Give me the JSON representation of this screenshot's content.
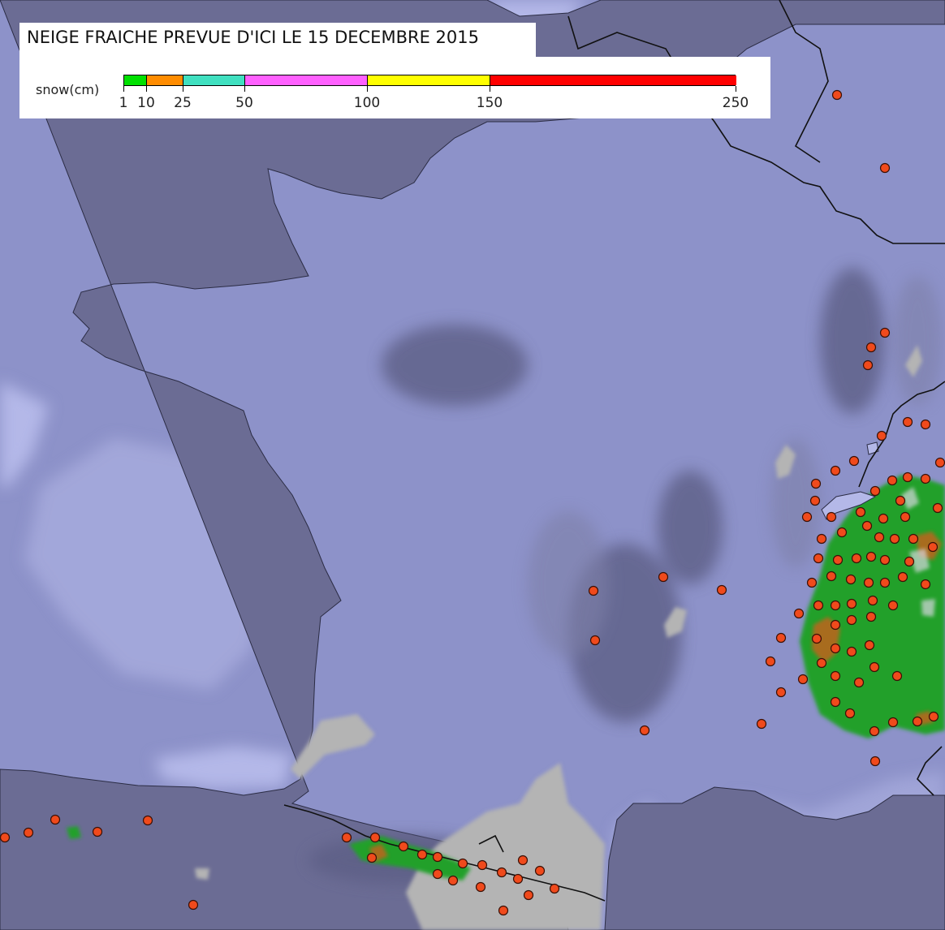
{
  "title": "NEIGE FRAICHE PREVUE D'ICI LE 15 DECEMBRE 2015",
  "legend": {
    "label": "snow(cm)",
    "breaks": [
      1,
      10,
      25,
      50,
      100,
      150,
      250
    ],
    "tick_labels": [
      "1",
      "10",
      "25",
      "50",
      "100",
      "150",
      "250"
    ],
    "colors": [
      "#00e000",
      "#ff8c00",
      "#40e0c0",
      "#ff60ff",
      "#ffff00",
      "#ff0000"
    ]
  },
  "map_colors": {
    "sea_deep": "#8d92c9",
    "sea_light": "#b4b8e8",
    "land": "#6b6c94",
    "land_shadow": "#5d5e86",
    "snow_trace": "#b4b4b4",
    "snow_green": "#22a02a",
    "snow_orange": "#c0641e",
    "border": "#111111",
    "station_fill": "#f04a1c",
    "station_stroke": "#3a1006"
  },
  "stations": [
    [
      1031,
      117
    ],
    [
      1090,
      207
    ],
    [
      1090,
      410
    ],
    [
      1073,
      428
    ],
    [
      1069,
      450
    ],
    [
      1118,
      520
    ],
    [
      1140,
      523
    ],
    [
      1086,
      537
    ],
    [
      1158,
      570
    ],
    [
      1052,
      568
    ],
    [
      1029,
      580
    ],
    [
      1005,
      596
    ],
    [
      1004,
      617
    ],
    [
      1099,
      592
    ],
    [
      1118,
      588
    ],
    [
      1140,
      590
    ],
    [
      1078,
      605
    ],
    [
      1109,
      617
    ],
    [
      994,
      637
    ],
    [
      1024,
      637
    ],
    [
      1060,
      631
    ],
    [
      1088,
      639
    ],
    [
      1115,
      637
    ],
    [
      1155,
      626
    ],
    [
      1012,
      664
    ],
    [
      1037,
      656
    ],
    [
      1068,
      648
    ],
    [
      1083,
      662
    ],
    [
      1102,
      664
    ],
    [
      1125,
      664
    ],
    [
      1149,
      674
    ],
    [
      1008,
      688
    ],
    [
      1032,
      690
    ],
    [
      1055,
      688
    ],
    [
      1073,
      686
    ],
    [
      1090,
      690
    ],
    [
      1120,
      692
    ],
    [
      1000,
      718
    ],
    [
      1024,
      710
    ],
    [
      1048,
      714
    ],
    [
      1070,
      718
    ],
    [
      1090,
      718
    ],
    [
      1112,
      711
    ],
    [
      1140,
      720
    ],
    [
      984,
      756
    ],
    [
      1008,
      746
    ],
    [
      1029,
      746
    ],
    [
      1049,
      744
    ],
    [
      1075,
      740
    ],
    [
      1100,
      746
    ],
    [
      1029,
      770
    ],
    [
      1049,
      764
    ],
    [
      1073,
      760
    ],
    [
      962,
      786
    ],
    [
      1006,
      787
    ],
    [
      1029,
      799
    ],
    [
      1049,
      803
    ],
    [
      1071,
      795
    ],
    [
      949,
      815
    ],
    [
      989,
      837
    ],
    [
      1012,
      817
    ],
    [
      1029,
      833
    ],
    [
      1058,
      841
    ],
    [
      1077,
      822
    ],
    [
      1105,
      833
    ],
    [
      962,
      853
    ],
    [
      1029,
      865
    ],
    [
      1047,
      879
    ],
    [
      1100,
      890
    ],
    [
      1130,
      889
    ],
    [
      1150,
      883
    ],
    [
      1077,
      901
    ],
    [
      1078,
      938
    ],
    [
      938,
      892
    ],
    [
      794,
      900
    ],
    [
      817,
      711
    ],
    [
      731,
      728
    ],
    [
      733,
      789
    ],
    [
      889,
      727
    ],
    [
      6,
      1032
    ],
    [
      35,
      1026
    ],
    [
      68,
      1010
    ],
    [
      120,
      1025
    ],
    [
      182,
      1011
    ],
    [
      238,
      1115
    ],
    [
      427,
      1032
    ],
    [
      462,
      1032
    ],
    [
      458,
      1057
    ],
    [
      497,
      1043
    ],
    [
      520,
      1053
    ],
    [
      539,
      1056
    ],
    [
      570,
      1064
    ],
    [
      594,
      1066
    ],
    [
      618,
      1075
    ],
    [
      644,
      1060
    ],
    [
      665,
      1073
    ],
    [
      539,
      1077
    ],
    [
      558,
      1085
    ],
    [
      592,
      1093
    ],
    [
      638,
      1083
    ],
    [
      683,
      1095
    ],
    [
      651,
      1103
    ],
    [
      620,
      1122
    ]
  ]
}
